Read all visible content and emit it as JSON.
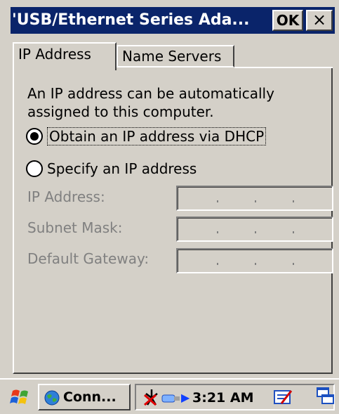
{
  "window": {
    "title": "'USB/Ethernet Series Ada...",
    "ok_label": "OK",
    "close_label": "×"
  },
  "tabs": [
    {
      "label": "IP Address",
      "active": true
    },
    {
      "label": "Name Servers",
      "active": false
    }
  ],
  "content": {
    "intro": "An IP address can be automatically assigned to this computer.",
    "options": [
      {
        "label": "Obtain an IP address via DHCP",
        "selected": true
      },
      {
        "label": "Specify an IP address",
        "selected": false
      }
    ],
    "fields": [
      {
        "label": "IP Address:",
        "value": ""
      },
      {
        "label": "Subnet Mask:",
        "value": ""
      },
      {
        "label": "Default Gateway:",
        "value": ""
      }
    ]
  },
  "taskbar": {
    "start_icon": "windows-flag-icon",
    "task_label": "Conn...",
    "time": "3:21 AM"
  },
  "colors": {
    "titlebar": "#0a246a",
    "face": "#d4d0c8",
    "disabled_text": "#808080"
  }
}
